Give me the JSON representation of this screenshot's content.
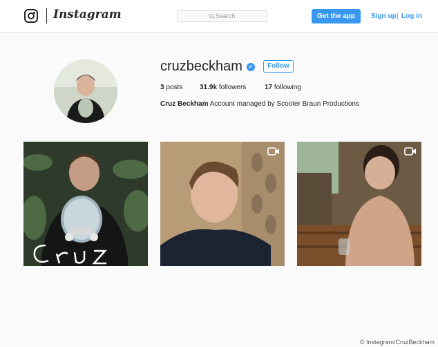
{
  "nav": {
    "brand": "Instagram",
    "search_placeholder": "Search",
    "get_app_label": "Get the app",
    "signup_label": "Sign up",
    "separator": "|",
    "login_label": "Log in"
  },
  "profile": {
    "username": "cruzbeckham",
    "verified": true,
    "follow_label": "Follow",
    "posts_count": "3",
    "posts_label": "posts",
    "followers_count": "31.9k",
    "followers_label": "followers",
    "following_count": "17",
    "following_label": "following",
    "full_name": "Cruz Beckham",
    "bio": "Account managed by Scooter Braun Productions"
  },
  "posts": [
    {
      "type": "image",
      "overlay_text": "CRUZ"
    },
    {
      "type": "video"
    },
    {
      "type": "video"
    }
  ],
  "credit": "© Instagram/CruzBeckham",
  "colors": {
    "accent": "#3897f0",
    "background": "#fafafa",
    "border": "#dbdbdb"
  }
}
